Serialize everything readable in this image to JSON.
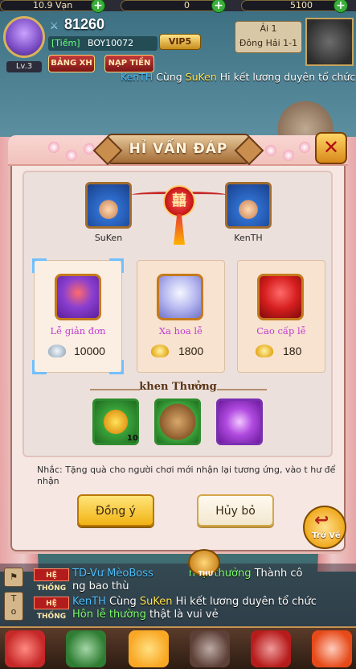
{
  "hud": {
    "resource_1": "10.9 Vạn",
    "resource_2": "0",
    "resource_3": "5100",
    "power": "81260",
    "guild_tag": "[Tiềm]",
    "player_name": "BOY10072",
    "vip": "VIP5",
    "level": "Lv.3",
    "btn_rank": "BẢNG XH",
    "btn_topup": "NẠP TIỀN",
    "map_line1": "Ải 1",
    "map_line2": "Đông Hải 1-1"
  },
  "marquee": {
    "name1": "KenTH",
    "mid": " Cùng ",
    "name2": "SuKen",
    "tail": " Hi kết lương duyên tổ chức"
  },
  "dialog": {
    "title": "HỈ VẤN ĐÁP",
    "close": "✕",
    "left_name": "SuKen",
    "right_name": "KenTH",
    "knot": "囍",
    "gifts": [
      {
        "name": "Lễ giản đơn",
        "price": "10000",
        "currency": "silver-ingot-icon",
        "color": "#c23bd4"
      },
      {
        "name": "Xa hoa lễ",
        "price": "1800",
        "currency": "gold-ingot-icon",
        "color": "#c23bd4"
      },
      {
        "name": "Cao cấp lễ",
        "price": "180",
        "currency": "gold-ingot-icon",
        "color": "#c23bd4"
      }
    ],
    "reward_title": "khen Thưởng",
    "rewards": [
      {
        "icon": "sunflower-icon",
        "count": "10"
      },
      {
        "icon": "wood-logs-icon",
        "count": ""
      },
      {
        "icon": "purple-orb-icon",
        "count": ""
      }
    ],
    "note": "Nhắc:  Tặng quà cho người chơi mới nhận lại tương ứng,  vào t hư để nhận",
    "confirm": "Đồng ý",
    "cancel": "Hủy bỏ",
    "back": "Trở Về",
    "back_arrow": "↩"
  },
  "chat": {
    "side_top": "⚑",
    "side_bottom": "T\no",
    "sys_tag": "HỆ THỐNG",
    "line1_a": "TD-",
    "line1_b": "Vư MèoBoss",
    "line1_c": "n lại thưởng",
    "line1_d": " Thành cô",
    "line2": "ng bao thù",
    "line3_a": "KenTH",
    "line3_b": " Cùng ",
    "line3_c": "SuKen",
    "line3_d": " Hi kết lương duyên tổ chức",
    "line4_a": "Hôn lễ thường",
    "line4_b": " thật là vui vẻ",
    "mail_label": "THƯ"
  },
  "colors": {
    "accent_gold": "#f1b314",
    "name_blue": "#4fc1ff",
    "name_yellow": "#ffe44d",
    "system_red": "#b31c1c"
  }
}
